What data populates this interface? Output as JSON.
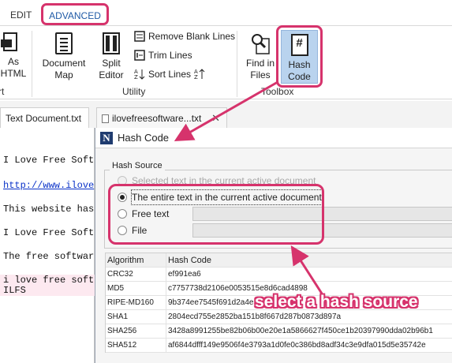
{
  "ribbon": {
    "tabs": [
      "EDIT",
      "ADVANCED"
    ],
    "buttons": {
      "save_as_html": [
        "As",
        "HTML"
      ],
      "document_map": [
        "Document",
        "Map"
      ],
      "split_editor": [
        "Split",
        "Editor"
      ],
      "find_in_files": [
        "Find in",
        "Files"
      ],
      "hash_code": [
        "Hash",
        "Code"
      ]
    },
    "small_commands": [
      "Remove Blank Lines",
      "Trim Lines",
      "Sort Lines"
    ],
    "groups": [
      "rt",
      "Utility",
      "Toolbox"
    ],
    "hash_icon_glyph": "#"
  },
  "document_tabs": [
    "Text Document.txt",
    "ilovefreesoftware...txt"
  ],
  "editor": {
    "lines": [
      "I Love Free Soft",
      "http://www.ilove",
      "This website has",
      "I Love Free Soft",
      "The free softwar",
      "i love free soft",
      "ILFS"
    ]
  },
  "dialog": {
    "logo": "N",
    "title": "Hash Code",
    "hash_source_label": "Hash Source",
    "options": [
      "Selected text in the current active document",
      "The entire text in the current active document",
      "Free text",
      "File"
    ],
    "selected_option": 1,
    "table": {
      "headers": [
        "Algorithm",
        "Hash Code"
      ],
      "rows": [
        [
          "CRC32",
          "ef991ea6"
        ],
        [
          "MD5",
          "c7757738d2106e0053515e8d6cad4898"
        ],
        [
          "RIPE-MD160",
          "9b374ee7545f691d2a4e"
        ],
        [
          "SHA1",
          "2804ecd755e2852ba151b8f667d287b0873d897a"
        ],
        [
          "SHA256",
          "3428a8991255be82b06b00e20e1a5866627f450ce1b20397990dda02b96b1"
        ],
        [
          "SHA512",
          "af6844dfff149e9506f4e3793a1d0fe0c386bd8adf34c3e9dfa015d5e35742e"
        ]
      ]
    }
  },
  "annotation": "select a hash source",
  "colors": {
    "highlight": "#d6336c",
    "accent_tab": "#1f5aa6",
    "hash_button_bg": "#b9d3ee"
  }
}
